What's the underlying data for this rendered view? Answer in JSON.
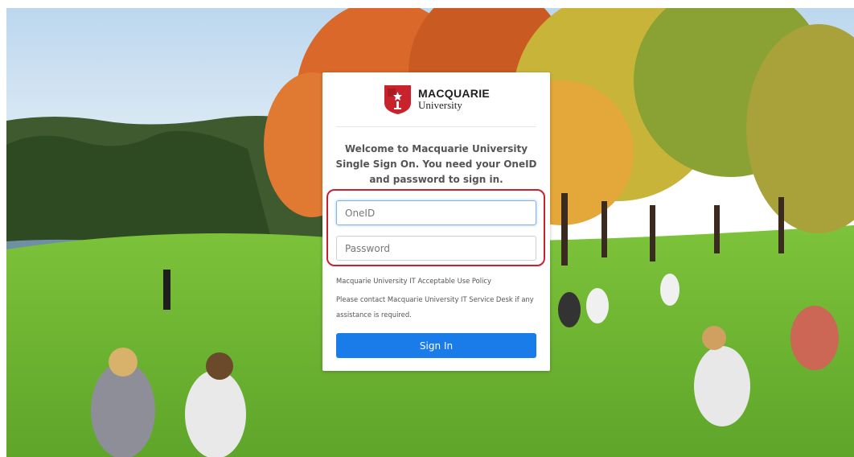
{
  "brand": {
    "name": "MACQUARIE",
    "subtitle": "University",
    "colors": {
      "shield_red": "#c8232c",
      "highlight_red": "#c8232c",
      "button_blue": "#1a7ce8"
    }
  },
  "login": {
    "welcome_text": "Welcome to Macquarie University Single Sign On. You need your OneID and password to sign in.",
    "oneid_placeholder": "OneID",
    "password_placeholder": "Password",
    "policy_text": "Macquarie University IT Acceptable Use Policy",
    "contact_text": "Please contact Macquarie University IT Service Desk if any assistance is required.",
    "signin_label": "Sign In"
  }
}
